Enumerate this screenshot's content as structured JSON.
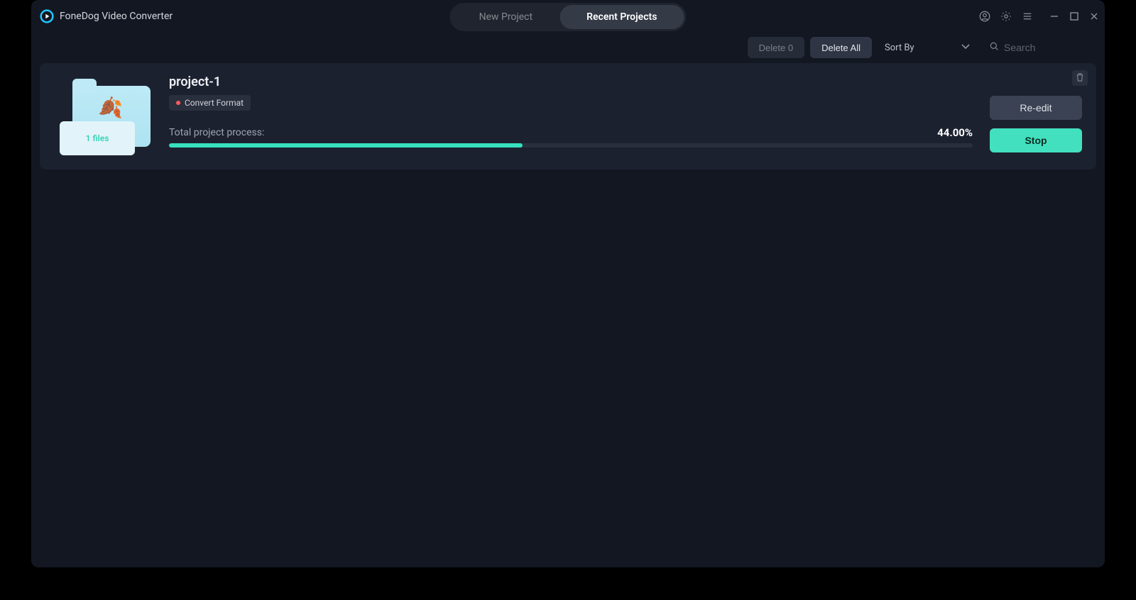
{
  "header": {
    "app_name": "FoneDog Video Converter",
    "tabs": [
      {
        "label": "New Project",
        "active": false
      },
      {
        "label": "Recent Projects",
        "active": true
      }
    ]
  },
  "toolbar": {
    "delete_n_label": "Delete 0",
    "delete_all_label": "Delete All",
    "sort_by_label": "Sort By",
    "search_placeholder": "Search"
  },
  "project": {
    "name": "project-1",
    "tag": "Convert Format",
    "files_label": "1 files",
    "process_label": "Total project process:",
    "progress_percent": 44.0,
    "progress_text": "44.00%",
    "reedit_label": "Re-edit",
    "stop_label": "Stop"
  },
  "colors": {
    "accent": "#42e0be"
  }
}
